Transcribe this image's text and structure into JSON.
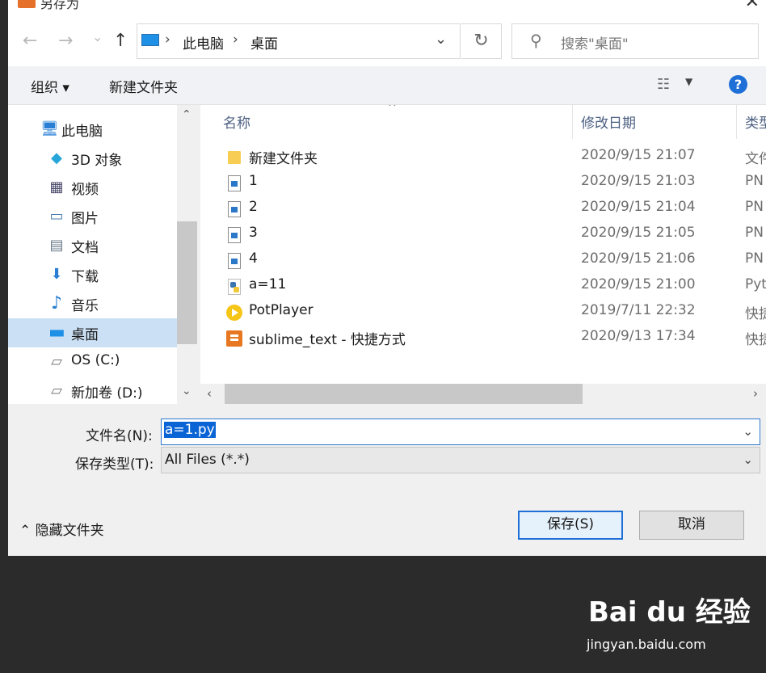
{
  "window": {
    "title": "另存为",
    "close_glyph": "✕"
  },
  "nav": {
    "back_glyph": "←",
    "forward_glyph": "→",
    "recent_glyph": "⌄",
    "up_glyph": "↑",
    "refresh_glyph": "↻",
    "breadcrumb": [
      "此电脑",
      "桌面"
    ],
    "breadcrumb_sep": "›",
    "address_dropdown_glyph": "⌄",
    "search_icon": "⚲",
    "search_placeholder": "搜索\"桌面\""
  },
  "toolbar": {
    "organize_label": "组织 ▾",
    "new_folder_label": "新建文件夹",
    "view_icon_glyph": "☷",
    "view_dropdown_glyph": "▼",
    "help_glyph": "?"
  },
  "sidebar": {
    "items": [
      {
        "label": "此电脑",
        "icon": "computer-icon",
        "glyph": "🖥",
        "selected": false
      },
      {
        "label": "3D 对象",
        "icon": "3d-objects-icon",
        "glyph": "◆",
        "selected": false
      },
      {
        "label": "视频",
        "icon": "videos-icon",
        "glyph": "▦",
        "selected": false
      },
      {
        "label": "图片",
        "icon": "pictures-icon",
        "glyph": "▭",
        "selected": false
      },
      {
        "label": "文档",
        "icon": "documents-icon",
        "glyph": "▤",
        "selected": false
      },
      {
        "label": "下载",
        "icon": "downloads-icon",
        "glyph": "⬇",
        "selected": false
      },
      {
        "label": "音乐",
        "icon": "music-icon",
        "glyph": "♪",
        "selected": false
      },
      {
        "label": "桌面",
        "icon": "desktop-icon",
        "glyph": "▬",
        "selected": true
      },
      {
        "label": "OS (C:)",
        "icon": "drive-c-icon",
        "glyph": "▱",
        "selected": false
      },
      {
        "label": "新加卷 (D:)",
        "icon": "drive-d-icon",
        "glyph": "▱",
        "selected": false
      }
    ],
    "scroll_up_glyph": "⌃",
    "scroll_down_glyph": "⌄"
  },
  "files": {
    "columns": [
      "名称",
      "修改日期",
      "类型"
    ],
    "sort_glyph": "^",
    "rows": [
      {
        "name": "新建文件夹",
        "date": "2020/9/15 21:07",
        "type": "文件",
        "icon": "folder"
      },
      {
        "name": "1",
        "date": "2020/9/15 21:03",
        "type": "PN",
        "icon": "png"
      },
      {
        "name": "2",
        "date": "2020/9/15 21:04",
        "type": "PN",
        "icon": "png"
      },
      {
        "name": "3",
        "date": "2020/9/15 21:05",
        "type": "PN",
        "icon": "png"
      },
      {
        "name": "4",
        "date": "2020/9/15 21:06",
        "type": "PN",
        "icon": "png"
      },
      {
        "name": "a=11",
        "date": "2020/9/15 21:00",
        "type": "Pyt",
        "icon": "py"
      },
      {
        "name": "PotPlayer",
        "date": "2019/7/11 22:32",
        "type": "快捷",
        "icon": "pot"
      },
      {
        "name": "sublime_text - 快捷方式",
        "date": "2020/9/13 17:34",
        "type": "快捷",
        "icon": "subl"
      }
    ],
    "hscroll_left_glyph": "‹",
    "hscroll_right_glyph": "›"
  },
  "form": {
    "filename_label": "文件名(N):",
    "filename_value": "a=1.py",
    "filetype_label": "保存类型(T):",
    "filetype_value": "All Files (*.*)",
    "dropdown_glyph": "⌄"
  },
  "footer": {
    "hide_folders_label": "⌃ 隐藏文件夹",
    "save_label": "保存(S)",
    "cancel_label": "取消"
  },
  "watermark": {
    "brand": "Bai du 经验",
    "url": "jingyan.baidu.com"
  }
}
